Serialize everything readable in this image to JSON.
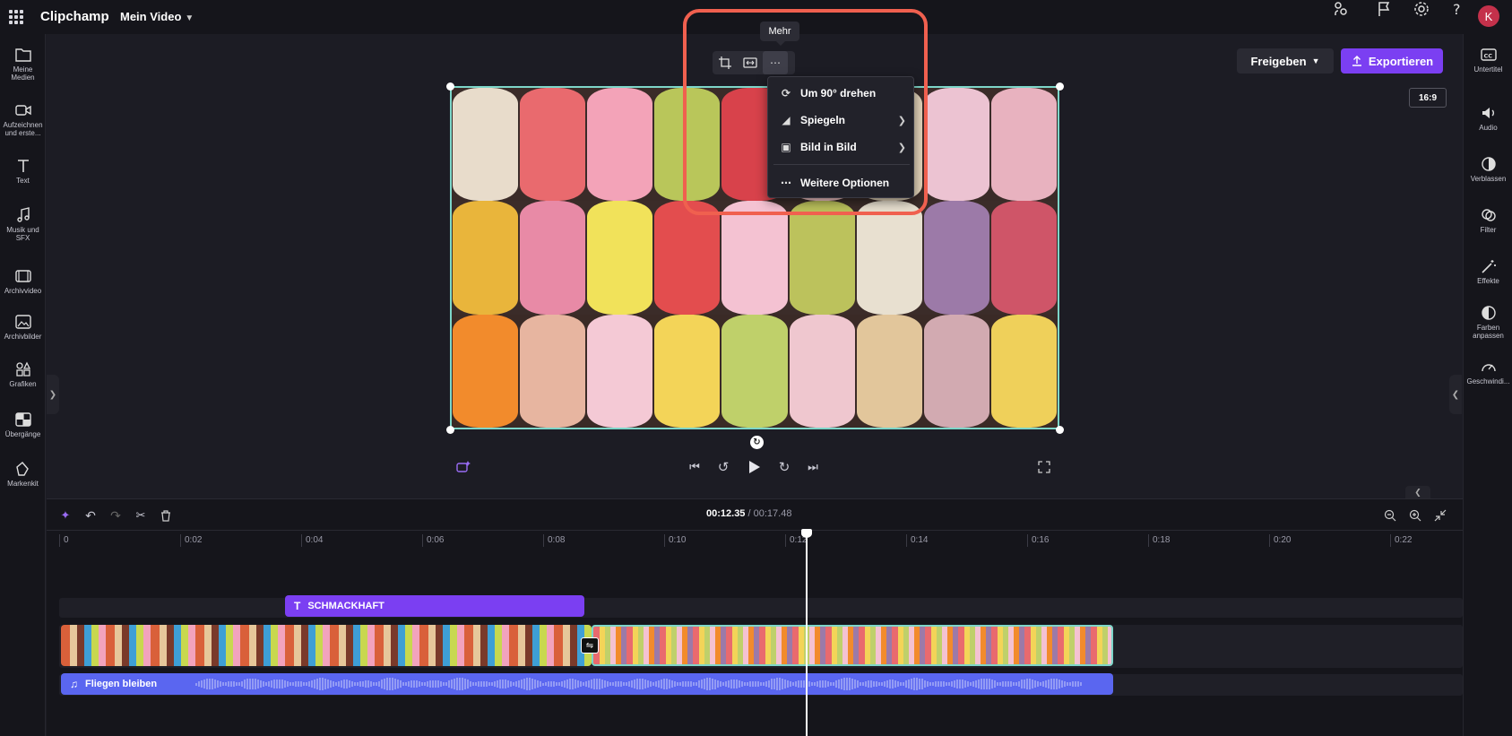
{
  "app": {
    "name": "Clipchamp",
    "project_name": "Mein Video",
    "user_initial": "K"
  },
  "header": {
    "share_label": "Freigeben",
    "export_label": "Exportieren",
    "aspect_ratio": "16:9"
  },
  "left_sidebar": {
    "items": [
      {
        "label": "Meine Medien",
        "icon": "folder-icon"
      },
      {
        "label": "Aufzeichnen und erste...",
        "icon": "camera-icon"
      },
      {
        "label": "Text",
        "icon": "text-icon"
      },
      {
        "label": "Musik und SFX",
        "icon": "music-icon"
      },
      {
        "label": "Archivvideo",
        "icon": "film-icon"
      },
      {
        "label": "Archivbilder",
        "icon": "image-icon"
      },
      {
        "label": "Grafiken",
        "icon": "shapes-icon"
      },
      {
        "label": "Übergänge",
        "icon": "transition-icon"
      },
      {
        "label": "Markenkit",
        "icon": "brand-kit-icon"
      }
    ]
  },
  "right_sidebar": {
    "items": [
      {
        "label": "Untertitel",
        "icon": "captions-icon"
      },
      {
        "label": "Audio",
        "icon": "speaker-icon"
      },
      {
        "label": "Verblassen",
        "icon": "fade-icon"
      },
      {
        "label": "Filter",
        "icon": "filter-icon"
      },
      {
        "label": "Effekte",
        "icon": "magic-wand-icon"
      },
      {
        "label": "Farben anpassen",
        "icon": "contrast-icon"
      },
      {
        "label": "Geschwindi...",
        "icon": "speed-icon"
      }
    ]
  },
  "context_toolbar": {
    "tooltip": "Mehr",
    "more_menu": [
      {
        "label": "Um 90° drehen",
        "icon": "rotate-icon",
        "submenu": false
      },
      {
        "label": "Spiegeln",
        "icon": "flip-icon",
        "submenu": true
      },
      {
        "label": "Bild in Bild",
        "icon": "picture-in-picture-icon",
        "submenu": true
      },
      {
        "label": "Weitere Optionen",
        "icon": "more-icon",
        "submenu": false
      }
    ]
  },
  "timeline": {
    "current_time": "00:12.35",
    "total_time": "/ 00:17.48",
    "ruler_ticks": [
      "0",
      "0:02",
      "0:04",
      "0:06",
      "0:08",
      "0:10",
      "0:12",
      "0:14",
      "0:16",
      "0:18",
      "0:20",
      "0:22"
    ],
    "text_clip_label": "SCHMACKHAFT",
    "audio_clip_label": "Fliegen bleiben"
  },
  "colors": {
    "accent": "#7b3ff2",
    "selection": "#7dd6c9",
    "highlight": "#f0604f",
    "audio": "#5a66f0"
  }
}
